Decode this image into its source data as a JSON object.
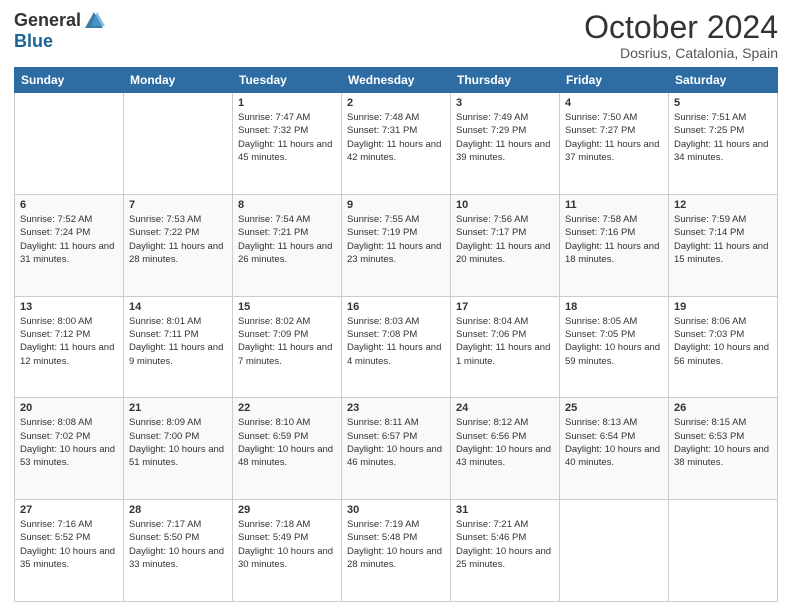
{
  "header": {
    "logo_general": "General",
    "logo_blue": "Blue",
    "month_title": "October 2024",
    "location": "Dosrius, Catalonia, Spain"
  },
  "weekdays": [
    "Sunday",
    "Monday",
    "Tuesday",
    "Wednesday",
    "Thursday",
    "Friday",
    "Saturday"
  ],
  "weeks": [
    [
      {
        "day": null
      },
      {
        "day": null
      },
      {
        "day": "1",
        "sunrise": "Sunrise: 7:47 AM",
        "sunset": "Sunset: 7:32 PM",
        "daylight": "Daylight: 11 hours and 45 minutes."
      },
      {
        "day": "2",
        "sunrise": "Sunrise: 7:48 AM",
        "sunset": "Sunset: 7:31 PM",
        "daylight": "Daylight: 11 hours and 42 minutes."
      },
      {
        "day": "3",
        "sunrise": "Sunrise: 7:49 AM",
        "sunset": "Sunset: 7:29 PM",
        "daylight": "Daylight: 11 hours and 39 minutes."
      },
      {
        "day": "4",
        "sunrise": "Sunrise: 7:50 AM",
        "sunset": "Sunset: 7:27 PM",
        "daylight": "Daylight: 11 hours and 37 minutes."
      },
      {
        "day": "5",
        "sunrise": "Sunrise: 7:51 AM",
        "sunset": "Sunset: 7:25 PM",
        "daylight": "Daylight: 11 hours and 34 minutes."
      }
    ],
    [
      {
        "day": "6",
        "sunrise": "Sunrise: 7:52 AM",
        "sunset": "Sunset: 7:24 PM",
        "daylight": "Daylight: 11 hours and 31 minutes."
      },
      {
        "day": "7",
        "sunrise": "Sunrise: 7:53 AM",
        "sunset": "Sunset: 7:22 PM",
        "daylight": "Daylight: 11 hours and 28 minutes."
      },
      {
        "day": "8",
        "sunrise": "Sunrise: 7:54 AM",
        "sunset": "Sunset: 7:21 PM",
        "daylight": "Daylight: 11 hours and 26 minutes."
      },
      {
        "day": "9",
        "sunrise": "Sunrise: 7:55 AM",
        "sunset": "Sunset: 7:19 PM",
        "daylight": "Daylight: 11 hours and 23 minutes."
      },
      {
        "day": "10",
        "sunrise": "Sunrise: 7:56 AM",
        "sunset": "Sunset: 7:17 PM",
        "daylight": "Daylight: 11 hours and 20 minutes."
      },
      {
        "day": "11",
        "sunrise": "Sunrise: 7:58 AM",
        "sunset": "Sunset: 7:16 PM",
        "daylight": "Daylight: 11 hours and 18 minutes."
      },
      {
        "day": "12",
        "sunrise": "Sunrise: 7:59 AM",
        "sunset": "Sunset: 7:14 PM",
        "daylight": "Daylight: 11 hours and 15 minutes."
      }
    ],
    [
      {
        "day": "13",
        "sunrise": "Sunrise: 8:00 AM",
        "sunset": "Sunset: 7:12 PM",
        "daylight": "Daylight: 11 hours and 12 minutes."
      },
      {
        "day": "14",
        "sunrise": "Sunrise: 8:01 AM",
        "sunset": "Sunset: 7:11 PM",
        "daylight": "Daylight: 11 hours and 9 minutes."
      },
      {
        "day": "15",
        "sunrise": "Sunrise: 8:02 AM",
        "sunset": "Sunset: 7:09 PM",
        "daylight": "Daylight: 11 hours and 7 minutes."
      },
      {
        "day": "16",
        "sunrise": "Sunrise: 8:03 AM",
        "sunset": "Sunset: 7:08 PM",
        "daylight": "Daylight: 11 hours and 4 minutes."
      },
      {
        "day": "17",
        "sunrise": "Sunrise: 8:04 AM",
        "sunset": "Sunset: 7:06 PM",
        "daylight": "Daylight: 11 hours and 1 minute."
      },
      {
        "day": "18",
        "sunrise": "Sunrise: 8:05 AM",
        "sunset": "Sunset: 7:05 PM",
        "daylight": "Daylight: 10 hours and 59 minutes."
      },
      {
        "day": "19",
        "sunrise": "Sunrise: 8:06 AM",
        "sunset": "Sunset: 7:03 PM",
        "daylight": "Daylight: 10 hours and 56 minutes."
      }
    ],
    [
      {
        "day": "20",
        "sunrise": "Sunrise: 8:08 AM",
        "sunset": "Sunset: 7:02 PM",
        "daylight": "Daylight: 10 hours and 53 minutes."
      },
      {
        "day": "21",
        "sunrise": "Sunrise: 8:09 AM",
        "sunset": "Sunset: 7:00 PM",
        "daylight": "Daylight: 10 hours and 51 minutes."
      },
      {
        "day": "22",
        "sunrise": "Sunrise: 8:10 AM",
        "sunset": "Sunset: 6:59 PM",
        "daylight": "Daylight: 10 hours and 48 minutes."
      },
      {
        "day": "23",
        "sunrise": "Sunrise: 8:11 AM",
        "sunset": "Sunset: 6:57 PM",
        "daylight": "Daylight: 10 hours and 46 minutes."
      },
      {
        "day": "24",
        "sunrise": "Sunrise: 8:12 AM",
        "sunset": "Sunset: 6:56 PM",
        "daylight": "Daylight: 10 hours and 43 minutes."
      },
      {
        "day": "25",
        "sunrise": "Sunrise: 8:13 AM",
        "sunset": "Sunset: 6:54 PM",
        "daylight": "Daylight: 10 hours and 40 minutes."
      },
      {
        "day": "26",
        "sunrise": "Sunrise: 8:15 AM",
        "sunset": "Sunset: 6:53 PM",
        "daylight": "Daylight: 10 hours and 38 minutes."
      }
    ],
    [
      {
        "day": "27",
        "sunrise": "Sunrise: 7:16 AM",
        "sunset": "Sunset: 5:52 PM",
        "daylight": "Daylight: 10 hours and 35 minutes."
      },
      {
        "day": "28",
        "sunrise": "Sunrise: 7:17 AM",
        "sunset": "Sunset: 5:50 PM",
        "daylight": "Daylight: 10 hours and 33 minutes."
      },
      {
        "day": "29",
        "sunrise": "Sunrise: 7:18 AM",
        "sunset": "Sunset: 5:49 PM",
        "daylight": "Daylight: 10 hours and 30 minutes."
      },
      {
        "day": "30",
        "sunrise": "Sunrise: 7:19 AM",
        "sunset": "Sunset: 5:48 PM",
        "daylight": "Daylight: 10 hours and 28 minutes."
      },
      {
        "day": "31",
        "sunrise": "Sunrise: 7:21 AM",
        "sunset": "Sunset: 5:46 PM",
        "daylight": "Daylight: 10 hours and 25 minutes."
      },
      {
        "day": null
      },
      {
        "day": null
      }
    ]
  ]
}
